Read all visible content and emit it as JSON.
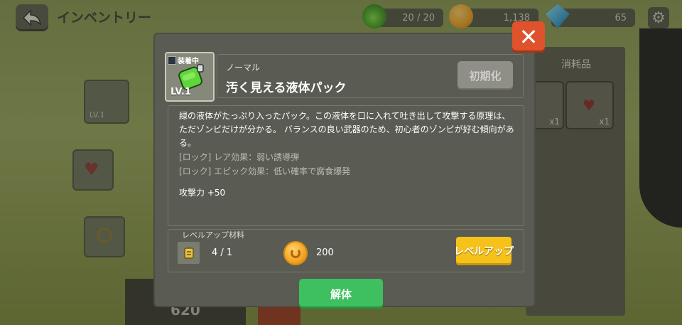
{
  "header": {
    "title": "インベントリー",
    "energy": "20 / 20",
    "gold": "1,138",
    "gems": "65"
  },
  "background": {
    "tab_consumables": "消耗品",
    "scroll_qty_1": "x1",
    "scroll_qty_2": "x1",
    "left_slot_level": "LV.1",
    "bottom_value": "620"
  },
  "item": {
    "equipped_badge": "装着中",
    "level": "LV.1",
    "rarity": "ノーマル",
    "name": "汚く見える液体パック",
    "reset_label": "初期化",
    "description": "緑の液体がたっぷり入ったパック。この液体を口に入れて吐き出して攻撃する原理は、ただゾンビだけが分かる。 バランスの良い武器のため、初心者のゾンビが好む傾向がある。",
    "effect_rare": "[ロック] レア効果：弱い誘導弾",
    "effect_epic": "[ロック] エピック効果：低い確率で腐食爆発",
    "attack": "攻撃力 +50"
  },
  "levelup": {
    "section_title": "レベルアップ材料",
    "material_count": "4 / 1",
    "gold_cost": "200",
    "button_label": "レベルアップ"
  },
  "actions": {
    "dismantle_label": "解体",
    "close_label": "✕"
  },
  "colors": {
    "accent_gold": "#f6c21a",
    "accent_green": "#3ec060",
    "close_red": "#e0522b"
  }
}
